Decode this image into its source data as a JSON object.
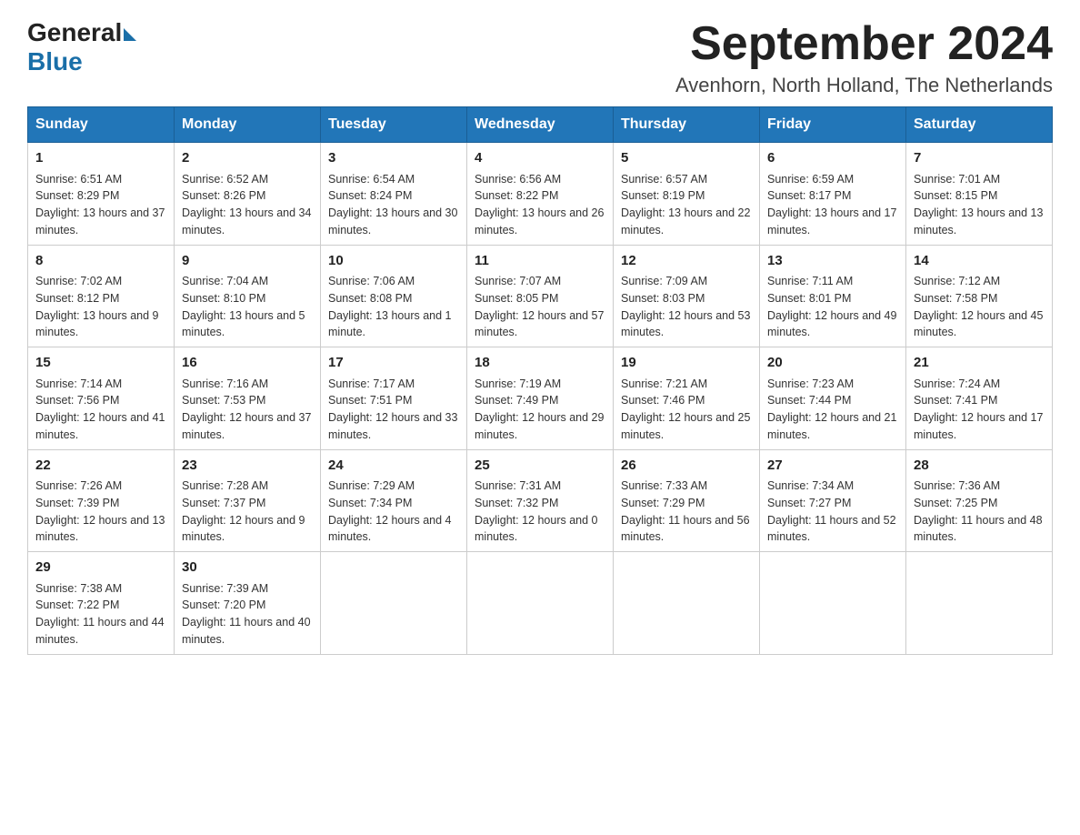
{
  "logo": {
    "general": "General",
    "blue": "Blue"
  },
  "header": {
    "title": "September 2024",
    "subtitle": "Avenhorn, North Holland, The Netherlands"
  },
  "weekdays": [
    "Sunday",
    "Monday",
    "Tuesday",
    "Wednesday",
    "Thursday",
    "Friday",
    "Saturday"
  ],
  "weeks": [
    [
      {
        "day": "1",
        "sunrise": "6:51 AM",
        "sunset": "8:29 PM",
        "daylight": "13 hours and 37 minutes."
      },
      {
        "day": "2",
        "sunrise": "6:52 AM",
        "sunset": "8:26 PM",
        "daylight": "13 hours and 34 minutes."
      },
      {
        "day": "3",
        "sunrise": "6:54 AM",
        "sunset": "8:24 PM",
        "daylight": "13 hours and 30 minutes."
      },
      {
        "day": "4",
        "sunrise": "6:56 AM",
        "sunset": "8:22 PM",
        "daylight": "13 hours and 26 minutes."
      },
      {
        "day": "5",
        "sunrise": "6:57 AM",
        "sunset": "8:19 PM",
        "daylight": "13 hours and 22 minutes."
      },
      {
        "day": "6",
        "sunrise": "6:59 AM",
        "sunset": "8:17 PM",
        "daylight": "13 hours and 17 minutes."
      },
      {
        "day": "7",
        "sunrise": "7:01 AM",
        "sunset": "8:15 PM",
        "daylight": "13 hours and 13 minutes."
      }
    ],
    [
      {
        "day": "8",
        "sunrise": "7:02 AM",
        "sunset": "8:12 PM",
        "daylight": "13 hours and 9 minutes."
      },
      {
        "day": "9",
        "sunrise": "7:04 AM",
        "sunset": "8:10 PM",
        "daylight": "13 hours and 5 minutes."
      },
      {
        "day": "10",
        "sunrise": "7:06 AM",
        "sunset": "8:08 PM",
        "daylight": "13 hours and 1 minute."
      },
      {
        "day": "11",
        "sunrise": "7:07 AM",
        "sunset": "8:05 PM",
        "daylight": "12 hours and 57 minutes."
      },
      {
        "day": "12",
        "sunrise": "7:09 AM",
        "sunset": "8:03 PM",
        "daylight": "12 hours and 53 minutes."
      },
      {
        "day": "13",
        "sunrise": "7:11 AM",
        "sunset": "8:01 PM",
        "daylight": "12 hours and 49 minutes."
      },
      {
        "day": "14",
        "sunrise": "7:12 AM",
        "sunset": "7:58 PM",
        "daylight": "12 hours and 45 minutes."
      }
    ],
    [
      {
        "day": "15",
        "sunrise": "7:14 AM",
        "sunset": "7:56 PM",
        "daylight": "12 hours and 41 minutes."
      },
      {
        "day": "16",
        "sunrise": "7:16 AM",
        "sunset": "7:53 PM",
        "daylight": "12 hours and 37 minutes."
      },
      {
        "day": "17",
        "sunrise": "7:17 AM",
        "sunset": "7:51 PM",
        "daylight": "12 hours and 33 minutes."
      },
      {
        "day": "18",
        "sunrise": "7:19 AM",
        "sunset": "7:49 PM",
        "daylight": "12 hours and 29 minutes."
      },
      {
        "day": "19",
        "sunrise": "7:21 AM",
        "sunset": "7:46 PM",
        "daylight": "12 hours and 25 minutes."
      },
      {
        "day": "20",
        "sunrise": "7:23 AM",
        "sunset": "7:44 PM",
        "daylight": "12 hours and 21 minutes."
      },
      {
        "day": "21",
        "sunrise": "7:24 AM",
        "sunset": "7:41 PM",
        "daylight": "12 hours and 17 minutes."
      }
    ],
    [
      {
        "day": "22",
        "sunrise": "7:26 AM",
        "sunset": "7:39 PM",
        "daylight": "12 hours and 13 minutes."
      },
      {
        "day": "23",
        "sunrise": "7:28 AM",
        "sunset": "7:37 PM",
        "daylight": "12 hours and 9 minutes."
      },
      {
        "day": "24",
        "sunrise": "7:29 AM",
        "sunset": "7:34 PM",
        "daylight": "12 hours and 4 minutes."
      },
      {
        "day": "25",
        "sunrise": "7:31 AM",
        "sunset": "7:32 PM",
        "daylight": "12 hours and 0 minutes."
      },
      {
        "day": "26",
        "sunrise": "7:33 AM",
        "sunset": "7:29 PM",
        "daylight": "11 hours and 56 minutes."
      },
      {
        "day": "27",
        "sunrise": "7:34 AM",
        "sunset": "7:27 PM",
        "daylight": "11 hours and 52 minutes."
      },
      {
        "day": "28",
        "sunrise": "7:36 AM",
        "sunset": "7:25 PM",
        "daylight": "11 hours and 48 minutes."
      }
    ],
    [
      {
        "day": "29",
        "sunrise": "7:38 AM",
        "sunset": "7:22 PM",
        "daylight": "11 hours and 44 minutes."
      },
      {
        "day": "30",
        "sunrise": "7:39 AM",
        "sunset": "7:20 PM",
        "daylight": "11 hours and 40 minutes."
      },
      null,
      null,
      null,
      null,
      null
    ]
  ],
  "labels": {
    "sunrise": "Sunrise:",
    "sunset": "Sunset:",
    "daylight": "Daylight:"
  }
}
